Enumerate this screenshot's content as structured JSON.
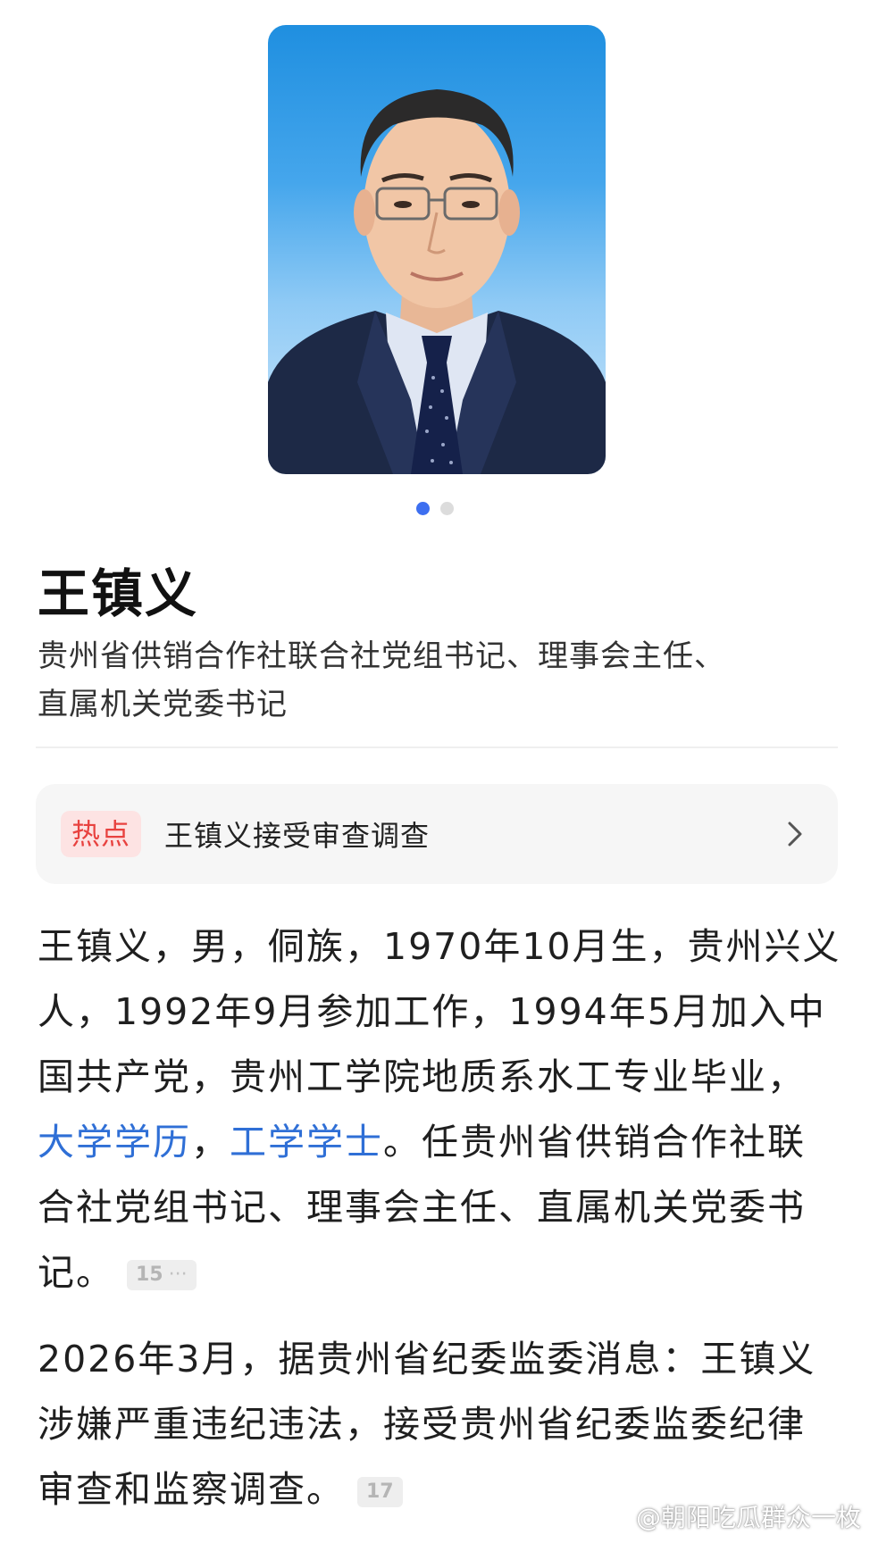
{
  "carousel": {
    "image_label": "portrait-photo",
    "total": 2,
    "active_index": 0
  },
  "profile": {
    "name": "王镇义",
    "subtitle_line1": "贵州省供销合作社联合社党组书记、理事会主任、",
    "subtitle_line2": "直属机关党委书记"
  },
  "hot": {
    "badge": "热点",
    "text": "王镇义接受审查调查"
  },
  "bio": {
    "p1_part1": "王镇义，男，侗族，1970年10月生，贵州兴义人，1992年9月参加工作，1994年5月加入中国共产党，贵州工学院地质系水工专业毕业，",
    "link_degree": "大学学历",
    "p1_sep": "，",
    "link_bachelor": "工学学士",
    "p1_part2": "。任贵州省供销合作社联合社党组书记、理事会主任、直属机关党委书记。",
    "cite1": "15",
    "cite1_more": "···",
    "p2": "2026年3月，据贵州省纪委监委消息：王镇义涉嫌严重违纪违法，接受贵州省纪委监委纪律审查和监察调查。",
    "cite2": "17"
  },
  "watermark": {
    "text": "@朝阳吃瓜群众一枚",
    "icon": "weibo-icon"
  },
  "colors": {
    "accent": "#3d6ff0",
    "link": "#2f6fd6",
    "hot_badge_bg": "#fde3e3",
    "hot_badge_text": "#e8423f"
  }
}
